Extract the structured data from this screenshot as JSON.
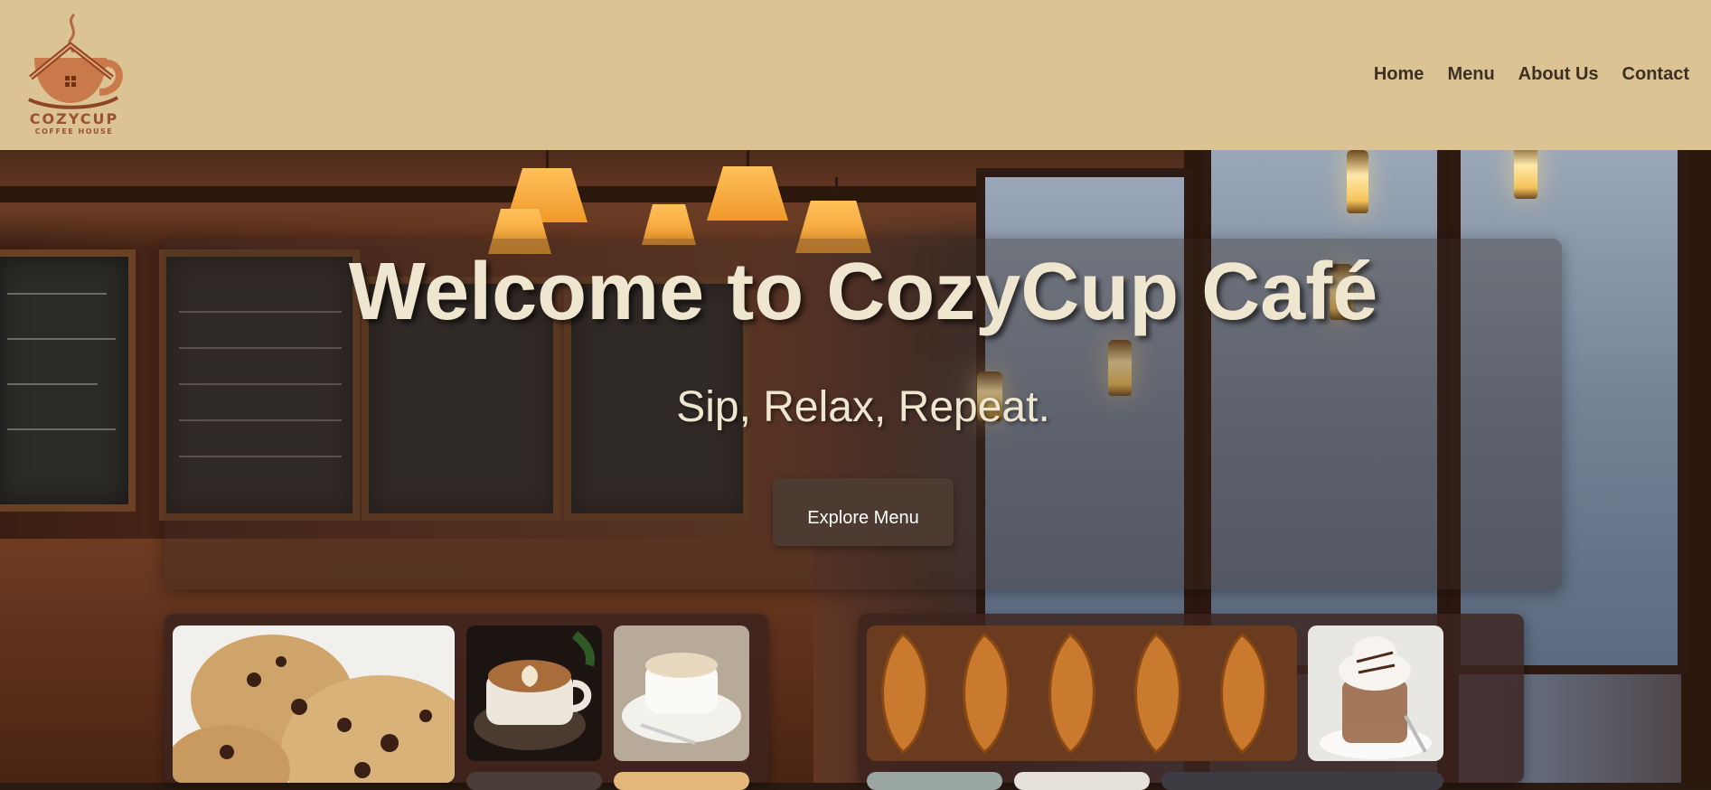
{
  "brand": {
    "name": "COZYCUP",
    "tagline": "COFFEE HOUSE",
    "logo_icon": "coffee-house-cup-icon",
    "accent_color": "#9b5230"
  },
  "nav": {
    "items": [
      {
        "label": "Home"
      },
      {
        "label": "Menu"
      },
      {
        "label": "About Us"
      },
      {
        "label": "Contact"
      }
    ]
  },
  "hero": {
    "title": "Welcome to CozyCup Café",
    "subtitle": "Sip, Relax, Repeat.",
    "cta_label": "Explore Menu"
  },
  "gallery": {
    "left_photos": [
      {
        "subject": "chocolate-chip-cookies"
      },
      {
        "subject": "latte-art-coffee"
      },
      {
        "subject": "cappuccino-cup"
      }
    ],
    "right_photos": [
      {
        "subject": "croissants"
      },
      {
        "subject": "iced-mocha-whipped-cream"
      }
    ]
  },
  "colors": {
    "header_bg": "#dbc393",
    "nav_text": "#3d2f26",
    "hero_text": "#efe6d0",
    "button_bg": "#4d3b31"
  }
}
